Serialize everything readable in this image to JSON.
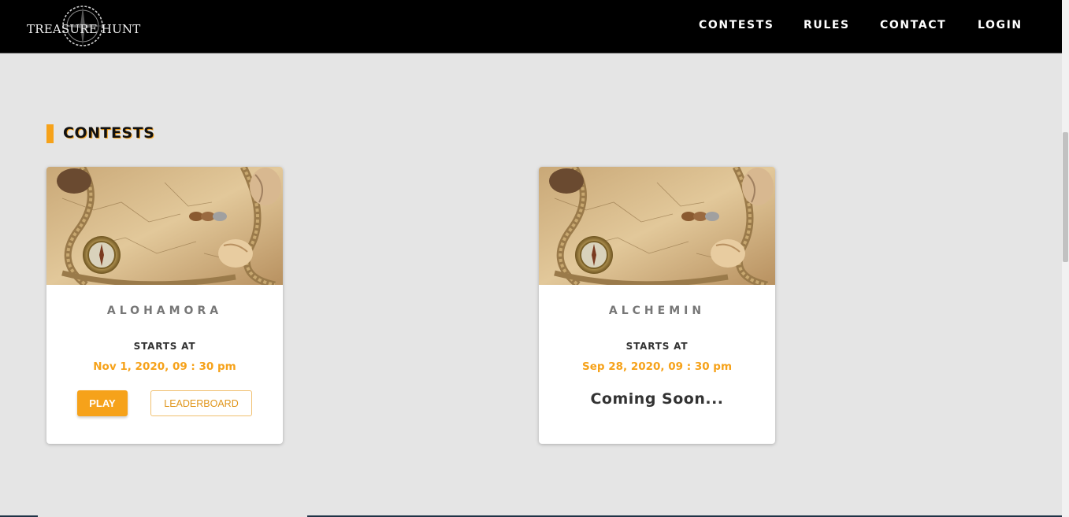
{
  "header": {
    "logo_text": "TREASURE HUNT",
    "nav": {
      "contests": "CONTESTS",
      "rules": "RULES",
      "contact": "CONTACT",
      "login": "LOGIN"
    }
  },
  "section": {
    "title": "CONTESTS"
  },
  "contests": [
    {
      "name": "ALOHAMORA",
      "starts_label": "STARTS AT",
      "starts_at": "Nov 1, 2020, 09 : 30 pm",
      "play_label": "PLAY",
      "leaderboard_label": "LEADERBOARD"
    },
    {
      "name": "ALCHEMIN",
      "starts_label": "STARTS AT",
      "starts_at": "Sep 28, 2020, 09 : 30 pm",
      "status": "Coming Soon..."
    }
  ],
  "colors": {
    "accent": "#f6a21a",
    "navbar_bg": "#000000",
    "page_bg": "#e5e5e5"
  }
}
